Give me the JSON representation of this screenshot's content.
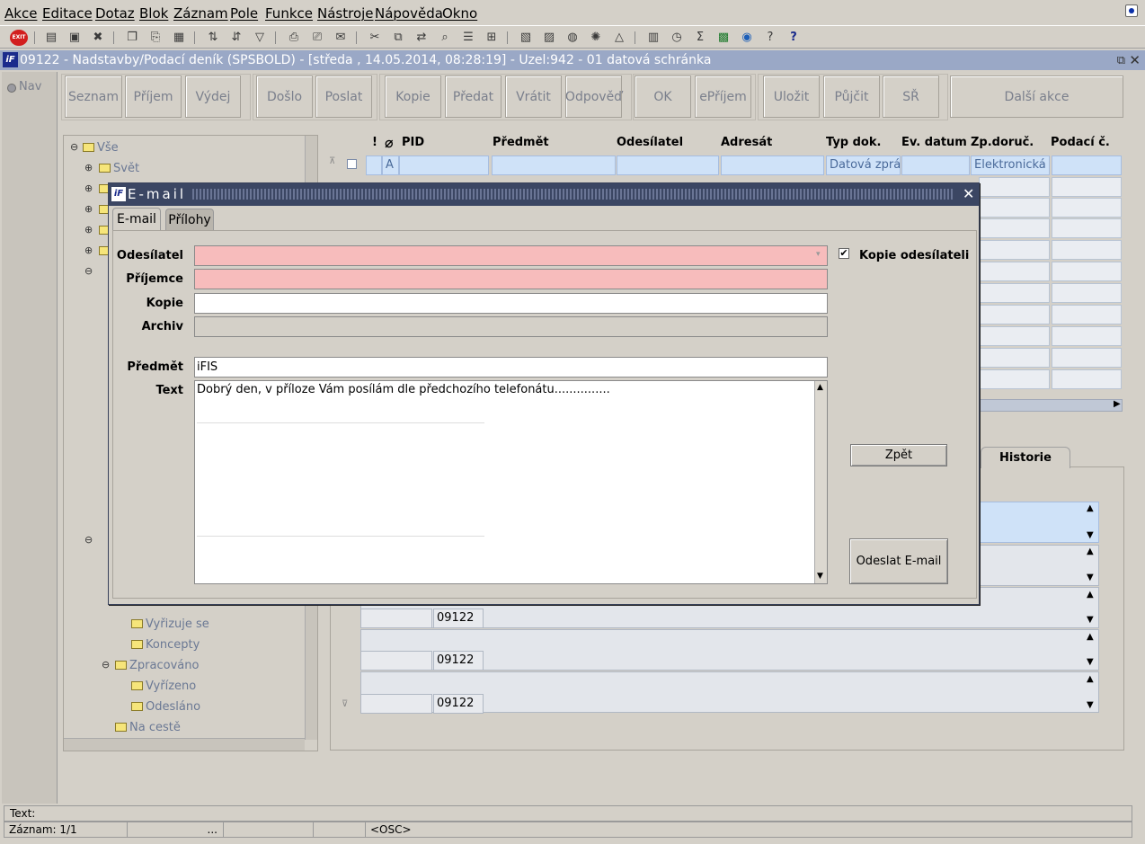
{
  "menu": [
    "Akce",
    "Editace",
    "Dotaz",
    "Blok",
    "Záznam",
    "Pole",
    "Funkce",
    "Nástroje",
    "Nápověda",
    "Okno"
  ],
  "app_title": "09122 - Nadstavby/Podací deník (SPSBOLD) - [středa , 14.05.2014, 08:28:19] - Uzel:942 - 01 datová schránka",
  "nav_label": "Nav",
  "buttons": {
    "seznam": "Seznam",
    "prijem": "Příjem",
    "vydej": "Výdej",
    "doslo": "Došlo",
    "poslat": "Poslat",
    "kopie": "Kopie",
    "predat": "Předat",
    "vratit": "Vrátit",
    "odpoved": "Odpověď",
    "ok": "OK",
    "eprijem": "ePříjem",
    "ulozit": "Uložit",
    "pujcit": "Půjčit",
    "sr": "SŘ",
    "dalsi": "Další akce"
  },
  "tree": {
    "root": "Vše",
    "svet": "Svět",
    "vyrizuje": "Vyřizuje se",
    "koncepty": "Koncepty",
    "zpracovano": "Zpracováno",
    "vyrizeno": "Vyřízeno",
    "odeslano": "Odesláno",
    "na_ceste": "Na cestě"
  },
  "grid": {
    "headers": {
      "excl": "!",
      "pid": "PID",
      "predmet": "Předmět",
      "odesilatel": "Odesílatel",
      "adresat": "Adresát",
      "typ": "Typ dok.",
      "ev_datum": "Ev. datum",
      "zp_doruc": "Zp.doruč.",
      "podaci": "Podací č."
    },
    "row1": {
      "flag": "A",
      "typ": "Datová zpráva",
      "zp_doruc": "Elektronická p"
    }
  },
  "history": {
    "tab": "Historie",
    "codes": [
      "09122",
      "09122",
      "09122"
    ]
  },
  "dialog": {
    "title": "E-mail",
    "tabs": [
      "E-mail",
      "Přílohy"
    ],
    "labels": {
      "odesilatel": "Odesílatel",
      "prijemce": "Příjemce",
      "kopie": "Kopie",
      "archiv": "Archiv",
      "predmet": "Předmět",
      "text": "Text"
    },
    "values": {
      "predmet": "iFIS",
      "text": "Dobrý den, v příloze Vám posílám dle předchozího telefonátu..............."
    },
    "checkbox_label": "Kopie odesílateli",
    "checkbox_checked": true,
    "btn_zpet": "Zpět",
    "btn_odeslat": "Odeslat E-mail"
  },
  "status": {
    "text_label": "Text:",
    "zaznam": "Záznam: 1/1",
    "dots": "...",
    "osc": "<OSC>"
  },
  "colors": {
    "dialog_title_bg": "#3b4663",
    "app_title_bg": "#9aa8c6",
    "required_field": "#f7bcbc",
    "selected_row": "#cfe2f8"
  }
}
